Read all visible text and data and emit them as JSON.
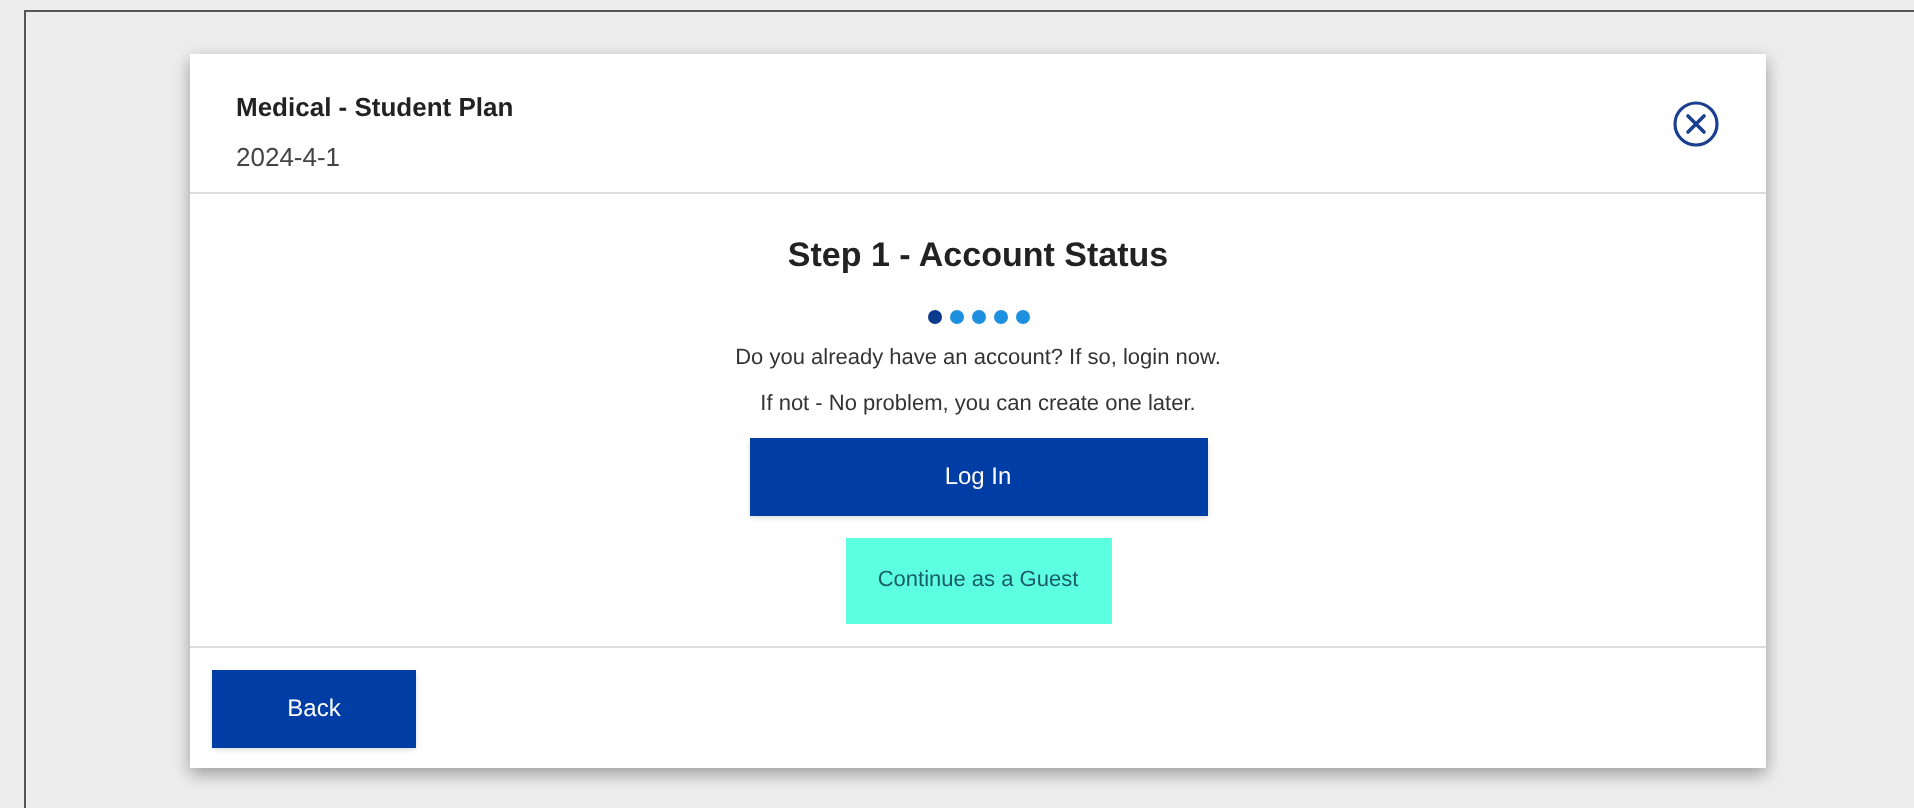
{
  "header": {
    "title": "Medical - Student Plan",
    "date": "2024-4-1"
  },
  "step": {
    "title": "Step 1 - Account Status",
    "dots": [
      {
        "selected": true
      },
      {
        "selected": false
      },
      {
        "selected": false
      },
      {
        "selected": false
      },
      {
        "selected": false
      }
    ],
    "lines": [
      "Do you already have an account? If so, login now.",
      "If not - No problem, you can create one later."
    ],
    "login_button": "Log In",
    "guest_button": "Continue as a Guest"
  },
  "footer": {
    "back_button": "Back"
  }
}
